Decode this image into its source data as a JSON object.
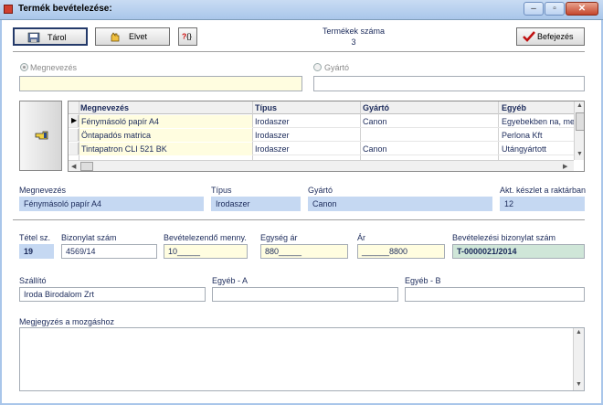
{
  "window": {
    "title": "Termék bevételezése:"
  },
  "toolbar": {
    "save_label": "Tárol",
    "discard_label": "Elvet",
    "help_label": "?{}",
    "finish_label": "Befejezés"
  },
  "count": {
    "label": "Termékek száma",
    "value": "3"
  },
  "search": {
    "name_option": "Megnevezés",
    "manufacturer_option": "Gyártó",
    "name_value": "",
    "manufacturer_value": ""
  },
  "grid": {
    "columns": [
      "Megnevezés",
      "Típus",
      "Gyártó",
      "Egyéb"
    ],
    "rows": [
      {
        "name": "Fénymásoló papír A4",
        "type": "Irodaszer",
        "manufacturer": "Canon",
        "other": "Egyebekben na, me"
      },
      {
        "name": "Öntapadós matrica",
        "type": "Irodaszer",
        "manufacturer": "",
        "other": "Perlona Kft"
      },
      {
        "name": "Tintapatron CLI 521 BK",
        "type": "Irodaszer",
        "manufacturer": "Canon",
        "other": "Utángyártott"
      }
    ]
  },
  "selected": {
    "name_label": "Megnevezés",
    "name_value": "Fénymásoló papír A4",
    "type_label": "Típus",
    "type_value": "Irodaszer",
    "manufacturer_label": "Gyártó",
    "manufacturer_value": "Canon",
    "stock_label": "Akt. készlet a raktárban",
    "stock_value": "12"
  },
  "entry": {
    "item_no_label": "Tétel sz.",
    "item_no_value": "19",
    "doc_no_label": "Bizonylat szám",
    "doc_no_value": "4569/14",
    "qty_label": "Bevételezendő menny.",
    "qty_value": "10_____",
    "unit_price_label": "Egység ár",
    "unit_price_value": "880_____",
    "price_label": "Ár",
    "price_value": "______8800",
    "receipt_label": "Bevételezési bizonylat szám",
    "receipt_value": "T-0000021/2014"
  },
  "supplier": {
    "supplier_label": "Szállító",
    "supplier_value": "Iroda Birodalom Zrt",
    "other_a_label": "Egyéb - A",
    "other_a_value": "",
    "other_b_label": "Egyéb - B",
    "other_b_value": ""
  },
  "notes": {
    "label": "Megjegyzés a mozgáshoz",
    "value": ""
  },
  "colors": {
    "titlebar": "#a9c6ea",
    "yellow_field": "#fffde0",
    "blue_field": "#c5d8f2",
    "green_field": "#cfe6d8",
    "text": "#1b2a5a"
  }
}
